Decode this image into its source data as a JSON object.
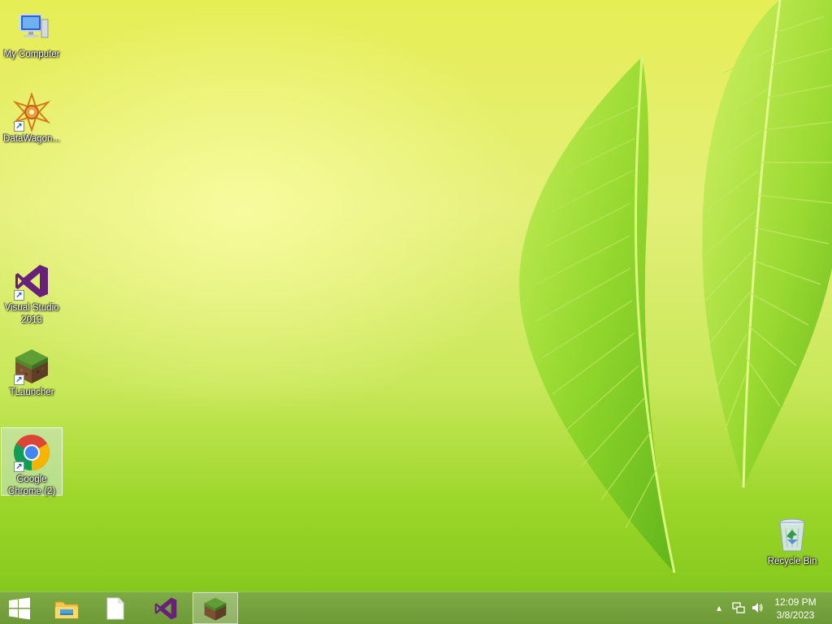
{
  "desktop": {
    "icons": [
      {
        "label": "My Computer",
        "icon": "computer-icon"
      },
      {
        "label": "DataWagon...",
        "icon": "datawagon-icon"
      },
      {
        "label": "Visual Studio 2013",
        "icon": "visual-studio-icon"
      },
      {
        "label": "TLauncher",
        "icon": "grass-block-icon"
      },
      {
        "label": "Google Chrome (2)",
        "icon": "chrome-icon"
      },
      {
        "label": "Recycle Bin",
        "icon": "recycle-bin-icon"
      }
    ]
  },
  "taskbar": {
    "start": {
      "icon": "windows-logo-icon"
    },
    "pinned": [
      {
        "name": "File Explorer",
        "icon": "file-explorer-icon"
      },
      {
        "name": "Blank document",
        "icon": "document-icon"
      },
      {
        "name": "Visual Studio",
        "icon": "visual-studio-icon"
      },
      {
        "name": "TLauncher",
        "icon": "grass-block-icon",
        "active": true
      }
    ],
    "tray": {
      "icons": [
        "show-hidden-icons-icon",
        "network-icon",
        "volume-icon"
      ],
      "time": "12:09 PM",
      "date": "3/8/2023"
    }
  },
  "colors": {
    "taskbar": "#6d9a36",
    "vs_purple": "#68217a",
    "chrome_red": "#db4437",
    "chrome_green": "#0f9d58",
    "chrome_yellow": "#f4b400",
    "chrome_blue": "#4285f4"
  }
}
